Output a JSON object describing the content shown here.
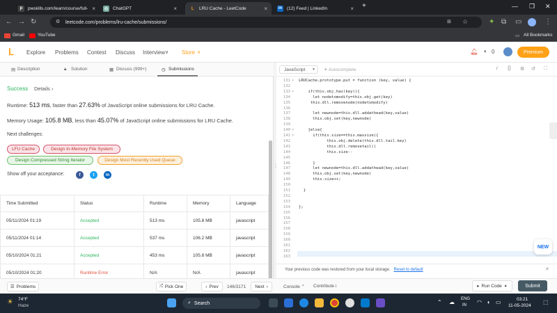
{
  "browser": {
    "tabs": [
      {
        "title": "pwskills.com/learn/course/full-",
        "favicon": "pw"
      },
      {
        "title": "ChatGPT",
        "favicon": "gpt"
      },
      {
        "title": "LRU Cache - LeetCode",
        "favicon": "lc"
      },
      {
        "title": "(12) Feed | LinkedIn",
        "favicon": "in"
      }
    ],
    "new_tab": "+",
    "url": "leetcode.com/problems/lru-cache/submissions/",
    "bookmarks": [
      "Gmail",
      "YouTube"
    ],
    "all_bookmarks": "All Bookmarks"
  },
  "header": {
    "nav": [
      "Explore",
      "Problems",
      "Contest",
      "Discuss",
      "Interview",
      "Store"
    ],
    "notifications": "0",
    "premium": "Premium"
  },
  "left": {
    "tabs": [
      "Description",
      "Solution",
      "Discuss (999+)",
      "Submissions"
    ],
    "status": "Success",
    "details": "Details",
    "runtime_prefix": "Runtime: ",
    "runtime_value": "513 ms",
    "runtime_mid": ", faster than ",
    "runtime_pct": "27.63%",
    "runtime_suffix": " of JavaScript online submissions for LRU Cache.",
    "memory_prefix": "Memory Usage: ",
    "memory_value": "105.8 MB",
    "memory_mid": ", less than ",
    "memory_pct": "45.07%",
    "memory_suffix": " of JavaScript online submissions for LRU Cache.",
    "next_challenges": "Next challenges:",
    "challenges": [
      "LFU Cache",
      "Design In-Memory File System",
      "Design Compressed String Iterator",
      "Design Most Recently Used Queue"
    ],
    "show_off": "Show off your acceptance:",
    "table": {
      "headers": [
        "Time Submitted",
        "Status",
        "Runtime",
        "Memory",
        "Language"
      ],
      "rows": [
        [
          "05/11/2024 01:19",
          "Accepted",
          "513 ms",
          "105.8 MB",
          "javascript"
        ],
        [
          "05/11/2024 01:14",
          "Accepted",
          "537 ms",
          "106.2 MB",
          "javascript"
        ],
        [
          "05/10/2024 01:21",
          "Accepted",
          "453 ms",
          "105.8 MB",
          "javascript"
        ],
        [
          "05/10/2024 01:20",
          "Runtime Error",
          "N/A",
          "N/A",
          "javascript"
        ]
      ]
    }
  },
  "bottom": {
    "problems": "Problems",
    "pick_one": "Pick One",
    "prev": "Prev",
    "page": "146/3171",
    "next": "Next",
    "console": "Console",
    "contribute": "Contribute",
    "run_code": "Run Code",
    "submit": "Submit"
  },
  "editor": {
    "language": "JavaScript",
    "autocomplete": "Autocomplete",
    "restore_msg": "Your previous code was restored from your local storage.",
    "reset_default": "Reset to default",
    "new_badge": "NEW",
    "lines": [
      {
        "n": "131",
        "fold": "▾",
        "code": "LRUCache.prototype.put = function (key, value) {"
      },
      {
        "n": "132",
        "fold": "",
        "code": ""
      },
      {
        "n": "133",
        "fold": "▾",
        "code": "    if(this.obj.has(key)){"
      },
      {
        "n": "134",
        "fold": "",
        "code": "      let nodetomodify=this.obj.get(key)"
      },
      {
        "n": "135",
        "fold": "",
        "code": "     this.dll.removenode(nodetomodify)"
      },
      {
        "n": "136",
        "fold": "",
        "code": ""
      },
      {
        "n": "137",
        "fold": "",
        "code": "      let newnode=this.dll.addathead(key,value)"
      },
      {
        "n": "138",
        "fold": "",
        "code": "      this.obj.set(key,newnode)"
      },
      {
        "n": "139",
        "fold": "",
        "code": ""
      },
      {
        "n": "140",
        "fold": "▾",
        "code": "    }else{"
      },
      {
        "n": "141",
        "fold": "▾",
        "code": "      if(this.size==this.maxsize){"
      },
      {
        "n": "142",
        "fold": "",
        "code": "            this.obj.delete(this.dll.tail.key)"
      },
      {
        "n": "143",
        "fold": "",
        "code": "            this.dll.removetail()"
      },
      {
        "n": "144",
        "fold": "",
        "code": "            this.size--"
      },
      {
        "n": "145",
        "fold": "",
        "code": ""
      },
      {
        "n": "146",
        "fold": "",
        "code": "      }"
      },
      {
        "n": "147",
        "fold": "",
        "code": "      let newnode=this.dll.addathead(key,value)"
      },
      {
        "n": "148",
        "fold": "",
        "code": "      this.obj.set(key,newnode)"
      },
      {
        "n": "149",
        "fold": "",
        "code": "      this.size++;"
      },
      {
        "n": "150",
        "fold": "",
        "code": ""
      },
      {
        "n": "151",
        "fold": "",
        "code": "  }"
      },
      {
        "n": "152",
        "fold": "",
        "code": ""
      },
      {
        "n": "153",
        "fold": "",
        "code": ""
      },
      {
        "n": "154",
        "fold": "",
        "code": "};"
      },
      {
        "n": "155",
        "fold": "",
        "code": ""
      },
      {
        "n": "156",
        "fold": "",
        "code": ""
      },
      {
        "n": "157",
        "fold": "",
        "code": ""
      },
      {
        "n": "158",
        "fold": "",
        "code": ""
      },
      {
        "n": "159",
        "fold": "",
        "code": ""
      },
      {
        "n": "160",
        "fold": "",
        "code": ""
      },
      {
        "n": "161",
        "fold": "",
        "code": ""
      },
      {
        "n": "162",
        "fold": "",
        "code": ""
      },
      {
        "n": "163",
        "fold": "",
        "code": ""
      }
    ]
  },
  "taskbar": {
    "temp": "74°F",
    "weather": "Haze",
    "search": "Search",
    "lang_top": "ENG",
    "lang_bottom": "IN",
    "time": "03:21",
    "date": "11-05-2024"
  },
  "colors": {
    "accent": "#ffa116",
    "success": "#2db55d",
    "error": "#e24b3b",
    "submit_bg": "#455a64"
  }
}
